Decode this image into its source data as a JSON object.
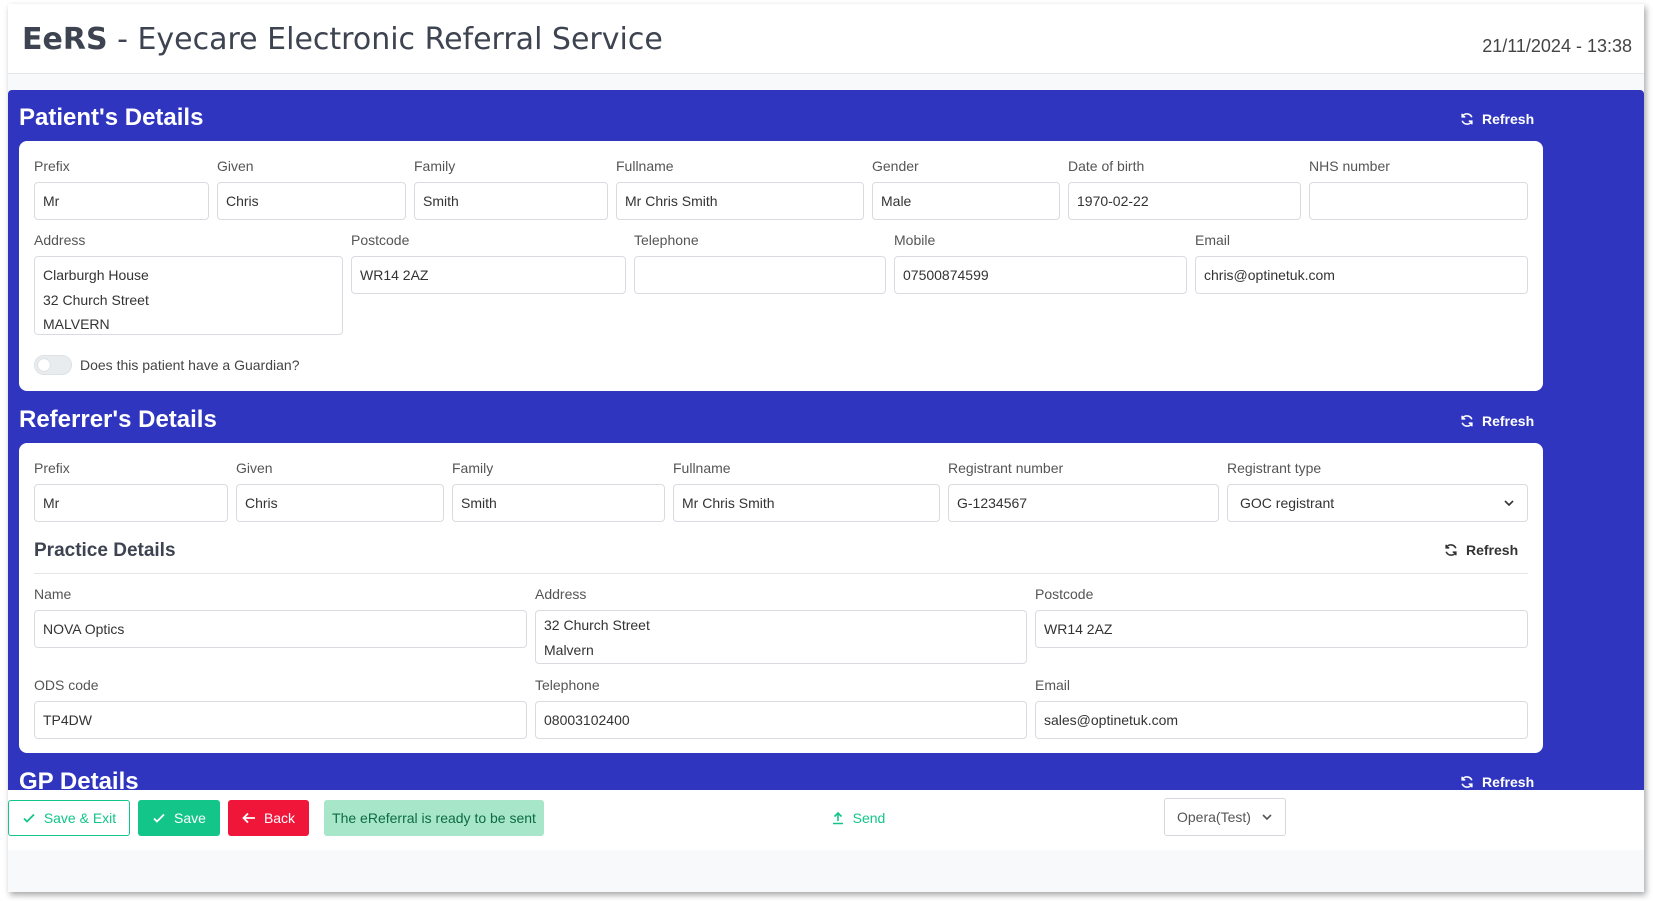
{
  "app": {
    "title_short": "EeRS",
    "title_rest": " - Eyecare Electronic Referral Service",
    "datetime": "21/11/2024 - 13:38"
  },
  "colors": {
    "brand_blue": "#2f35bf",
    "success_green": "#14c58a",
    "danger_red": "#f0163a",
    "ready_badge_bg": "#a8e6c9"
  },
  "patient": {
    "title": "Patient's Details",
    "refresh_label": "Refresh",
    "labels": {
      "prefix": "Prefix",
      "given": "Given",
      "family": "Family",
      "fullname": "Fullname",
      "gender": "Gender",
      "dob": "Date of birth",
      "nhs": "NHS number",
      "address": "Address",
      "postcode": "Postcode",
      "telephone": "Telephone",
      "mobile": "Mobile",
      "email": "Email"
    },
    "values": {
      "prefix": "Mr",
      "given": "Chris",
      "family": "Smith",
      "fullname": "Mr Chris Smith",
      "gender": "Male",
      "dob": "1970-02-22",
      "nhs": "",
      "address_lines": [
        "Clarburgh House",
        "32 Church Street",
        "MALVERN"
      ],
      "postcode": "WR14 2AZ",
      "telephone": "",
      "mobile": "07500874599",
      "email": "chris@optinetuk.com"
    },
    "guardian_label": "Does this patient have a Guardian?",
    "guardian_on": false
  },
  "referrer": {
    "title": "Referrer's Details",
    "refresh_label": "Refresh",
    "labels": {
      "prefix": "Prefix",
      "given": "Given",
      "family": "Family",
      "fullname": "Fullname",
      "registrant_number": "Registrant number",
      "registrant_type": "Registrant type"
    },
    "values": {
      "prefix": "Mr",
      "given": "Chris",
      "family": "Smith",
      "fullname": "Mr Chris Smith",
      "registrant_number": "G-1234567",
      "registrant_type": "GOC registrant"
    }
  },
  "practice": {
    "title": "Practice Details",
    "refresh_label": "Refresh",
    "labels": {
      "name": "Name",
      "address": "Address",
      "postcode": "Postcode",
      "ods": "ODS code",
      "telephone": "Telephone",
      "email": "Email"
    },
    "values": {
      "name": "NOVA Optics",
      "address_lines": [
        "32 Church Street",
        "Malvern"
      ],
      "postcode": "WR14 2AZ",
      "ods": "TP4DW",
      "telephone": "08003102400",
      "email": "sales@optinetuk.com"
    }
  },
  "gp": {
    "title": "GP Details",
    "refresh_label": "Refresh"
  },
  "footer": {
    "save_exit_label": "Save & Exit",
    "save_label": "Save",
    "back_label": "Back",
    "status_text": "The eReferral is ready to be sent",
    "send_label": "Send",
    "system_select": "Opera(Test)"
  },
  "icons": {
    "refresh": "refresh-icon",
    "check": "check-icon",
    "arrow_left": "arrow-left-icon",
    "upload": "upload-icon",
    "chevron_down": "chevron-down-icon"
  }
}
